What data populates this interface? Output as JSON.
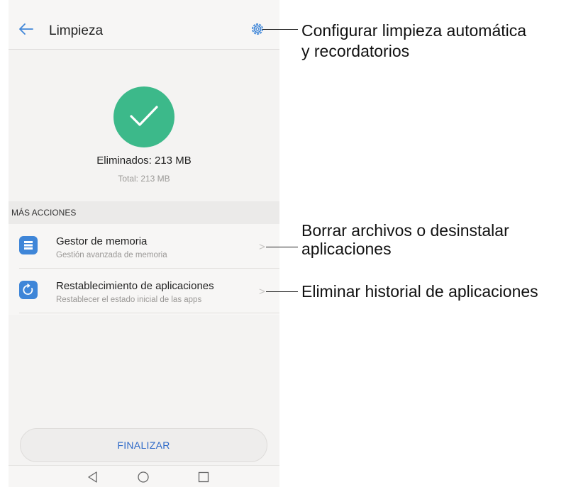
{
  "app": {
    "title": "Limpieza"
  },
  "result": {
    "deleted": "Eliminados: 213 MB",
    "total": "Total: 213 MB"
  },
  "section": {
    "header": "MÁS ACCIONES"
  },
  "actions": [
    {
      "title": "Gestor de memoria",
      "subtitle": "Gestión avanzada de memoria",
      "icon": "storage-list-icon"
    },
    {
      "title": "Restablecimiento de aplicaciones",
      "subtitle": "Restablecer el estado inicial de las apps",
      "icon": "reset-arrow-icon"
    }
  ],
  "finish_button": "FINALIZAR",
  "callouts": {
    "settings": [
      "Configurar limpieza automática",
      "y recordatorios"
    ],
    "memory": [
      "Borrar archivos o desinstalar",
      "aplicaciones"
    ],
    "reset": "Eliminar historial de aplicaciones"
  },
  "colors": {
    "success_circle": "#3cb98a",
    "action_icon": "#3f86d8",
    "accent_text": "#2f6ac8"
  },
  "icons": [
    "back-arrow-icon",
    "gear-icon",
    "checkmark-icon",
    "chevron-right-icon",
    "nav-back-icon",
    "nav-home-icon",
    "nav-recents-icon"
  ]
}
